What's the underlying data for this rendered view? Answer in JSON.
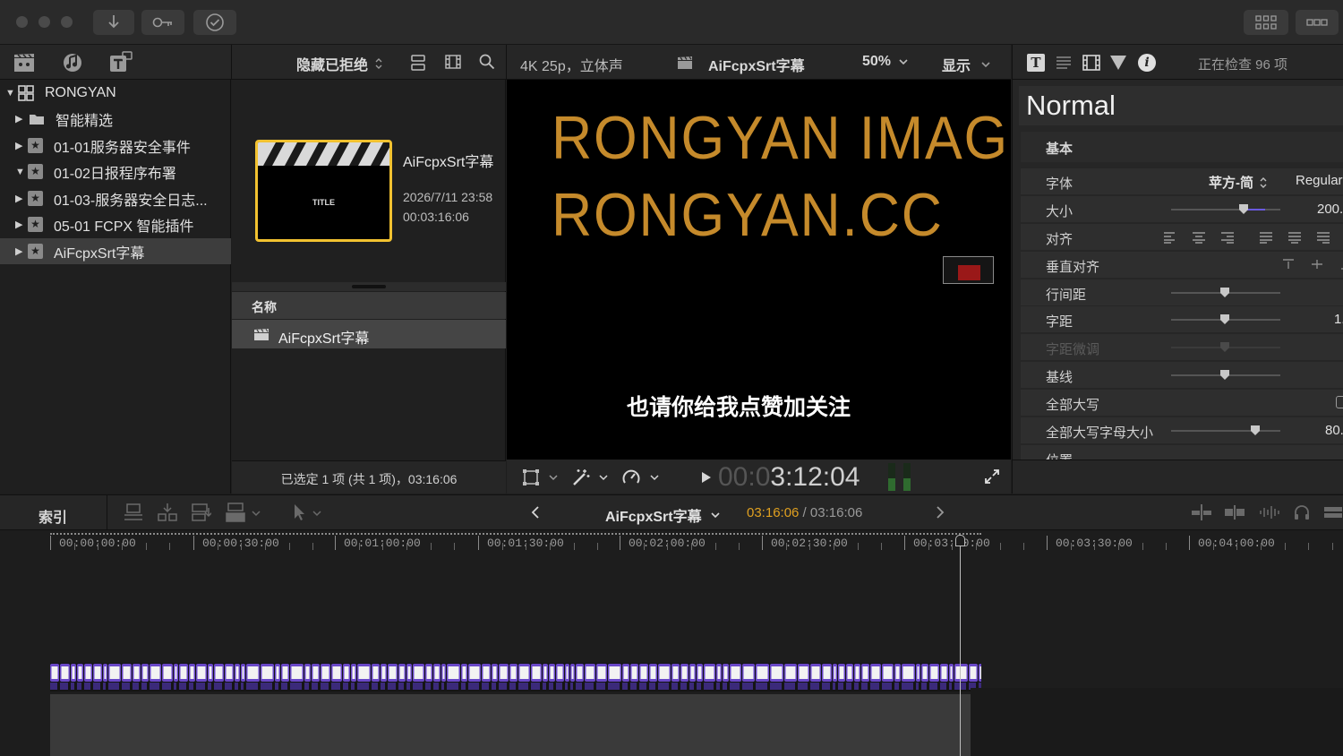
{
  "browser_header": {
    "filter_label": "隐藏已拒绝"
  },
  "viewer_header": {
    "format": "4K 25p，立体声",
    "project_name": "AiFcpxSrt字幕",
    "zoom": "50%",
    "view_menu": "显示"
  },
  "inspector_header": {
    "status": "正在检查 96 项"
  },
  "library": {
    "root": "RONGYAN",
    "items": [
      {
        "label": "智能精选",
        "expanded": false
      },
      {
        "label": "01-01服务器安全事件",
        "expanded": false
      },
      {
        "label": "01-02日报程序布署",
        "expanded": true
      },
      {
        "label": "01-03-服务器安全日志...",
        "expanded": false
      },
      {
        "label": "05-01 FCPX 智能插件",
        "expanded": false
      },
      {
        "label": "AiFcpxSrt字幕",
        "expanded": false
      }
    ]
  },
  "clip_card": {
    "thumb_text": "TITLE",
    "title": "AiFcpxSrt字幕",
    "date": "2026/7/11 23:58",
    "duration": "00:03:16:06"
  },
  "list": {
    "column_name": "名称",
    "row_label": "AiFcpxSrt字幕"
  },
  "browser_footer": "已选定 1 项 (共 1 项)，03:16:06",
  "viewer": {
    "big_text_line1": "RONGYAN IMAGE",
    "big_text_line2": "RONGYAN.CC",
    "subtitle": "也请你给我点赞加关注",
    "timecode_dim": "00:0",
    "timecode_bright": "3:12:04",
    "accent_color": "#c58a2b"
  },
  "inspector": {
    "style_name": "Normal",
    "section_basic": "基本",
    "rows": {
      "font": {
        "label": "字体",
        "value": "苹方-简",
        "weight": "Regular"
      },
      "size": {
        "label": "大小",
        "value": "200."
      },
      "align": {
        "label": "对齐"
      },
      "valign": {
        "label": "垂直对齐"
      },
      "line_spacing": {
        "label": "行间距"
      },
      "tracking": {
        "label": "字距",
        "value": "1."
      },
      "kerning": {
        "label": "字距微调"
      },
      "baseline": {
        "label": "基线"
      },
      "all_caps": {
        "label": "全部大写"
      },
      "all_caps_size": {
        "label": "全部大写字母大小",
        "value": "80."
      },
      "position": {
        "label": "位置"
      }
    }
  },
  "timeline_bar": {
    "index_label": "索引",
    "project_name": "AiFcpxSrt字幕",
    "current_time": "03:16:06",
    "separator": " / ",
    "total_time": "03:16:06"
  },
  "ruler": [
    "00:00:00:00",
    "00:00:30:00",
    "00:01:00:00",
    "00:01:30:00",
    "00:02:00:00",
    "00:02:30:00",
    "00:03:00:00",
    "00:03:30:00",
    "00:04:00:00"
  ],
  "icons": [
    "import-icon",
    "keywords-icon",
    "check-icon",
    "libraries-icon",
    "photos-audio-icon",
    "titles-generators-icon",
    "clip-appearance-icon",
    "filmstrip-icon",
    "search-icon",
    "clapper-icon",
    "text-inspector-icon",
    "video-inspector-icon",
    "info-icon",
    "transform-icon",
    "enhance-icon",
    "speed-icon",
    "play-icon",
    "fullscreen-icon",
    "arrow-tool-icon",
    "headphones-icon"
  ],
  "colors": {
    "selection_yellow": "#f2c230",
    "timecode_orange": "#e0a020",
    "caption_purple": "#6a48c8"
  }
}
